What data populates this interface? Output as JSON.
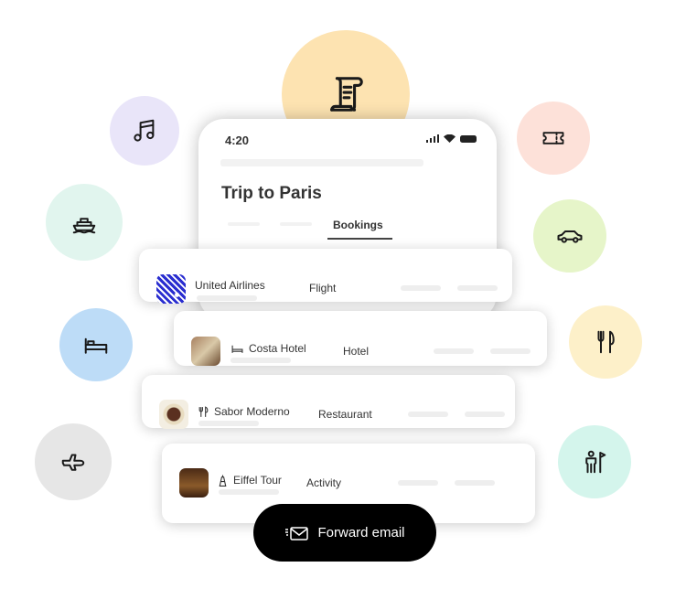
{
  "phone": {
    "time": "4:20",
    "title": "Trip to Paris",
    "active_tab": "Bookings"
  },
  "bookings": [
    {
      "name": "United Airlines",
      "type": "Flight",
      "icon": "airline-logo"
    },
    {
      "name": "Costa Hotel",
      "type": "Hotel",
      "icon": "bed-icon"
    },
    {
      "name": "Sabor Moderno",
      "type": "Restaurant",
      "icon": "fork-knife-icon"
    },
    {
      "name": "Eiffel Tour",
      "type": "Activity",
      "icon": "eiffel-tower-icon"
    }
  ],
  "forward_button": {
    "label": "Forward email"
  },
  "colors": {
    "music": "#e9e5f9",
    "ship": "#e1f5ee",
    "bed": "#bddcf7",
    "plane": "#e6e6e6",
    "receipt": "#fde3b1",
    "ticket": "#fde1d9",
    "car": "#e6f5c9",
    "fork": "#fdf0c9",
    "guide": "#d4f5ec"
  }
}
